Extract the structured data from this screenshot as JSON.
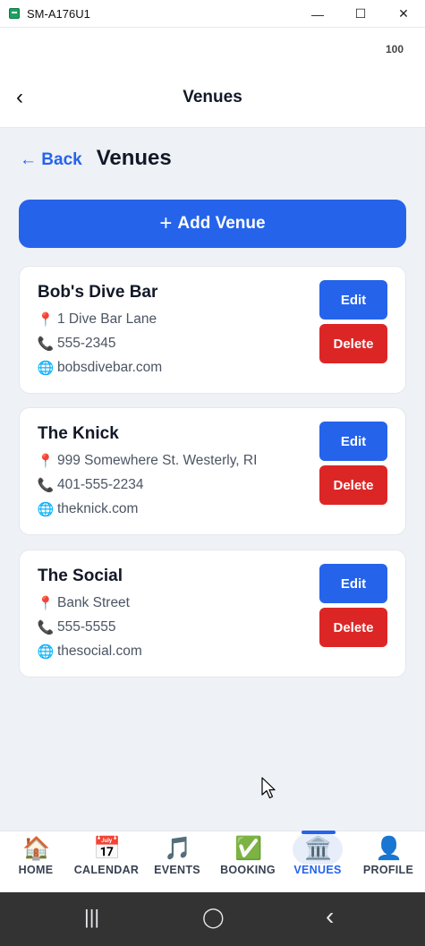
{
  "window": {
    "title": "SM-A176U1",
    "minimize": "—",
    "maximize": "☐",
    "close": "✕"
  },
  "status": {
    "battery": "100"
  },
  "appbar": {
    "back_icon": "‹",
    "title": "Venues"
  },
  "page": {
    "back_label": "← Back",
    "heading": "Venues"
  },
  "add_button": {
    "icon": "+",
    "label": "Add Venue"
  },
  "venues": [
    {
      "name": "Bob's Dive Bar",
      "address": "1 Dive Bar Lane",
      "phone": "555-2345",
      "website": "bobsdivebar.com"
    },
    {
      "name": "The Knick",
      "address": "999 Somewhere St. Westerly, RI",
      "phone": "401-555-2234",
      "website": "theknick.com"
    },
    {
      "name": "The Social",
      "address": "Bank Street",
      "phone": "555-5555",
      "website": "thesocial.com"
    }
  ],
  "card_actions": {
    "edit": "Edit",
    "delete": "Delete"
  },
  "row_icons": {
    "address": "📍",
    "phone": "📞",
    "website": "🌐"
  },
  "nav": [
    {
      "label": "HOME",
      "icon": "🏠"
    },
    {
      "label": "CALENDAR",
      "icon": "📅"
    },
    {
      "label": "EVENTS",
      "icon": "🎵"
    },
    {
      "label": "BOOKING",
      "icon": "✅"
    },
    {
      "label": "VENUES",
      "icon": "🏛️"
    },
    {
      "label": "PROFILE",
      "icon": "👤"
    }
  ],
  "sysnav": {
    "recents": "|||",
    "home": "◯",
    "back": "‹"
  },
  "colors": {
    "primary": "#2563eb",
    "danger": "#dc2626",
    "background": "#eef1f6"
  }
}
